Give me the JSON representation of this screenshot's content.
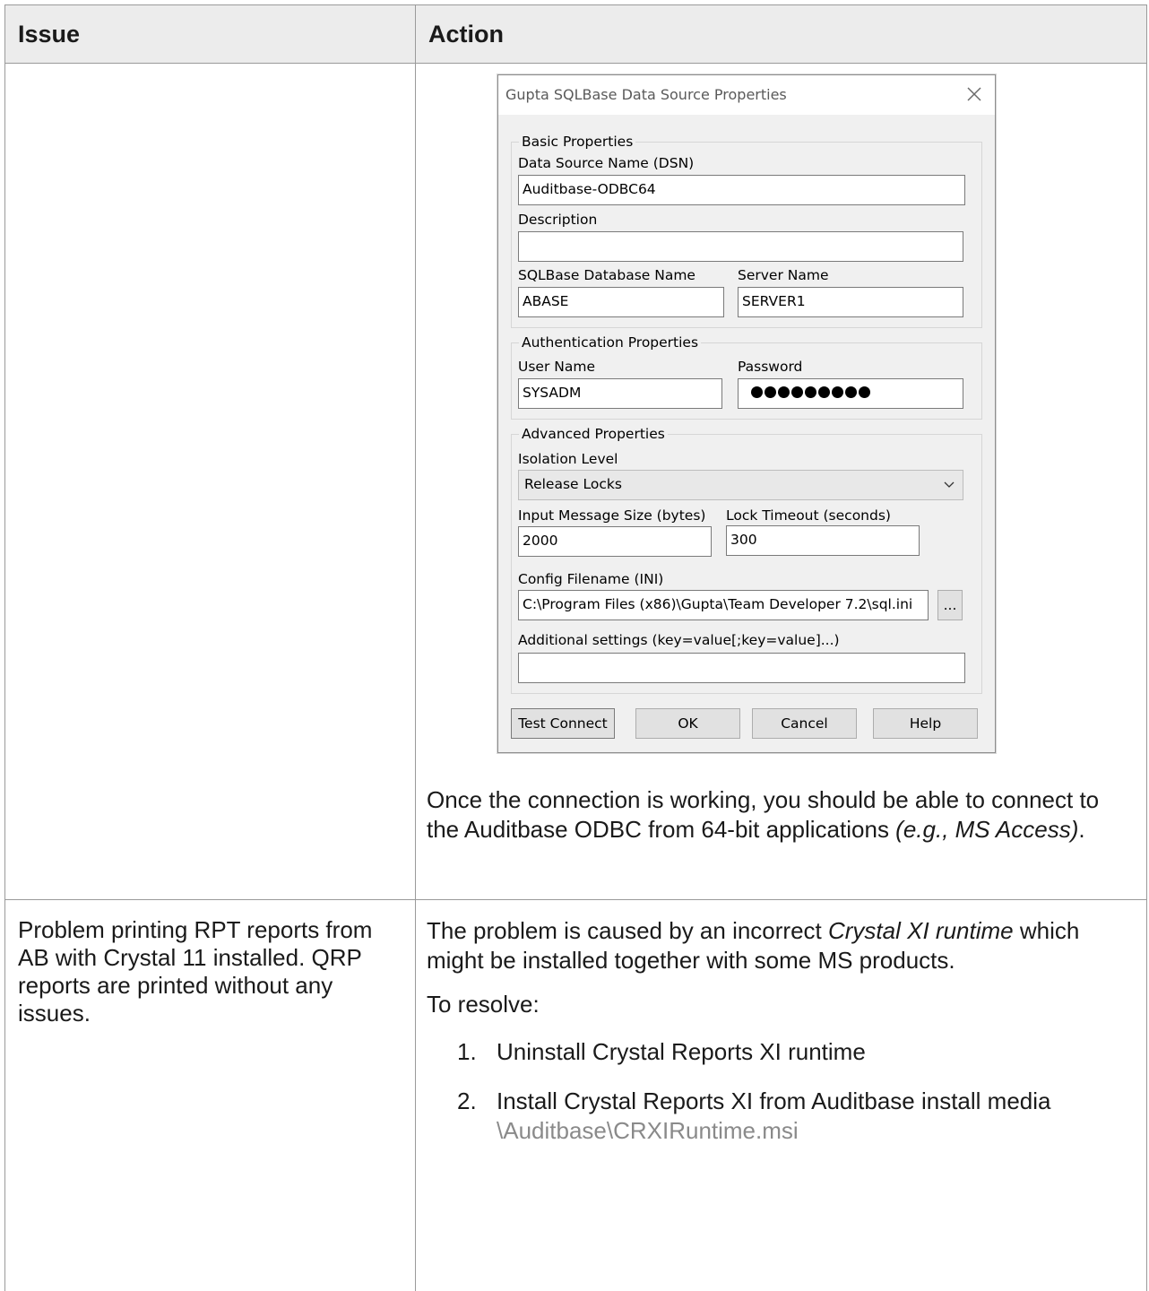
{
  "table": {
    "header_issue": "Issue",
    "header_action": "Action"
  },
  "row1": {
    "issue": "",
    "after_text_1": "Once the connection is working, you should be able to connect to the Auditbase ODBC from 64-bit applications ",
    "after_text_em": "(e.g., MS Access)",
    "after_text_2": "."
  },
  "dialog": {
    "title": "Gupta SQLBase Data Source Properties",
    "basic_group": "Basic Properties",
    "dsn_label": "Data Source Name (DSN)",
    "dsn_value": "Auditbase-ODBC64",
    "description_label": "Description",
    "description_value": "",
    "db_name_label": "SQLBase Database Name",
    "db_name_value": "ABASE",
    "server_label": "Server Name",
    "server_value": "SERVER1",
    "auth_group": "Authentication Properties",
    "user_label": "User Name",
    "user_value": "SYSADM",
    "password_label": "Password",
    "password_mask_count": 9,
    "advanced_group": "Advanced Properties",
    "isolation_label": "Isolation Level",
    "isolation_value": "Release Locks",
    "msg_size_label": "Input Message Size (bytes)",
    "msg_size_value": "2000",
    "lock_timeout_label": "Lock Timeout (seconds)",
    "lock_timeout_value": "300",
    "config_label": "Config Filename (INI)",
    "config_value": "C:\\Program Files (x86)\\Gupta\\Team Developer 7.2\\sql.ini",
    "browse_label": "...",
    "additional_label": "Additional settings (key=value[;key=value]...)",
    "additional_value": "",
    "test_connect_label": "Test Connect",
    "ok_label": "OK",
    "cancel_label": "Cancel",
    "help_label": "Help"
  },
  "row2": {
    "issue": "Problem printing RPT reports from AB with Crystal 11 installed. QRP reports are printed without any issues.",
    "action_p1_a": "The problem is caused by an incorrect ",
    "action_p1_em": "Crystal XI runtime",
    "action_p1_b": " which might be installed together with some MS products.",
    "action_p2": "To resolve:",
    "steps": [
      {
        "num": "1.",
        "text": "Uninstall Crystal Reports XI runtime",
        "path": ""
      },
      {
        "num": "2.",
        "text": "Install Crystal Reports XI from Auditbase install media ",
        "path": "\\Auditbase\\CRXIRuntime.msi"
      }
    ]
  },
  "icons": {
    "close": "close-icon",
    "chevron": "chevron-down-icon"
  }
}
